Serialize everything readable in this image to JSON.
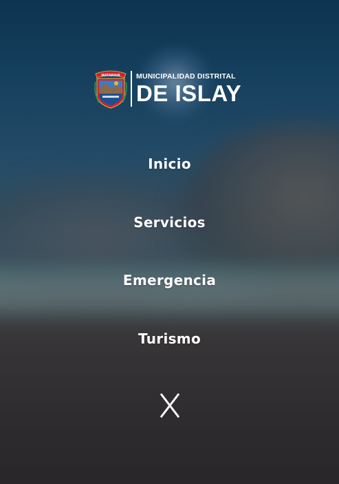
{
  "logo": {
    "top_line": "MUNICIPALIDAD DISTRITAL",
    "main_line": "DE ISLAY",
    "crest_icon": "municipal-crest-icon",
    "crest_banner_text": "MATARANI"
  },
  "menu": {
    "items": [
      {
        "label": "Inicio"
      },
      {
        "label": "Servicios"
      },
      {
        "label": "Emergencia"
      },
      {
        "label": "Turismo"
      }
    ],
    "close_icon": "close-icon"
  },
  "colors": {
    "text": "#ffffff",
    "sky_top": "#0e3a5a",
    "sand": "#2f2a2b",
    "crest_red": "#c8262c",
    "crest_blue": "#3a7bc8",
    "crest_gold": "#e0b84a"
  }
}
